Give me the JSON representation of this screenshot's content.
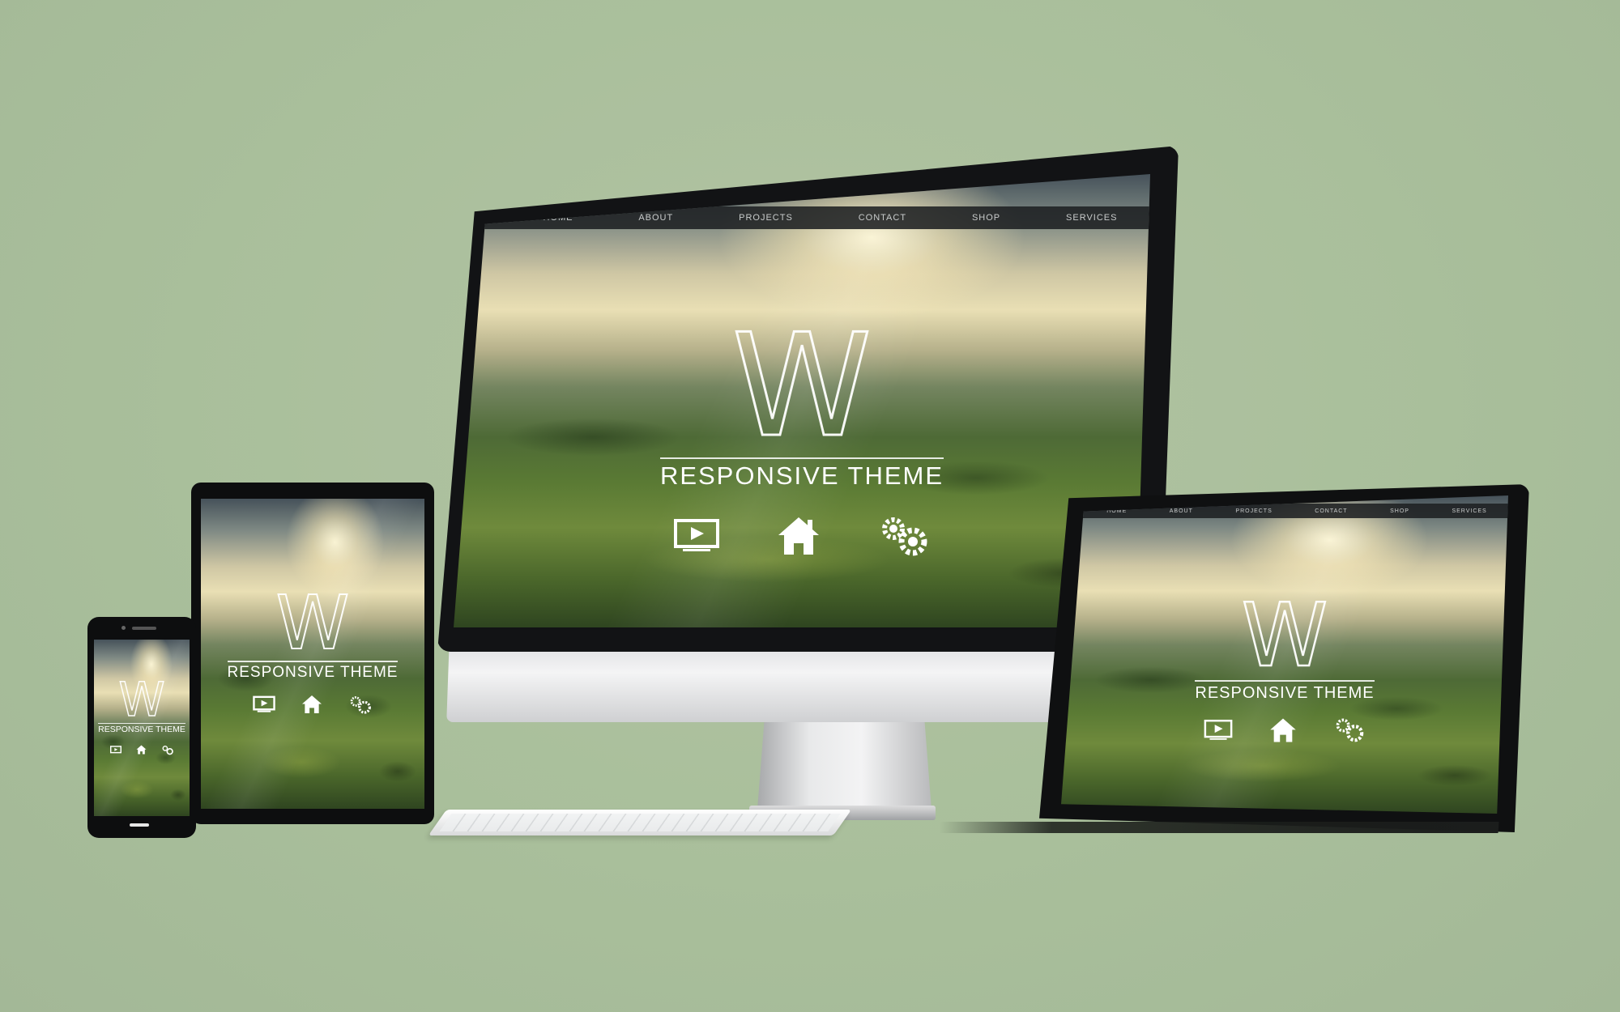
{
  "brand_letter": "W",
  "theme_title": "RESPONSIVE THEME",
  "nav": {
    "items": [
      "HOME",
      "ABOUT",
      "PROJECTS",
      "CONTACT",
      "SHOP",
      "SERVICES"
    ]
  },
  "icons": [
    "video-play-icon",
    "home-icon",
    "gears-icon"
  ],
  "colors": {
    "background": "#a9bf9b",
    "bezel": "#121315",
    "navbar": "#1e2022",
    "text": "#ffffff"
  }
}
